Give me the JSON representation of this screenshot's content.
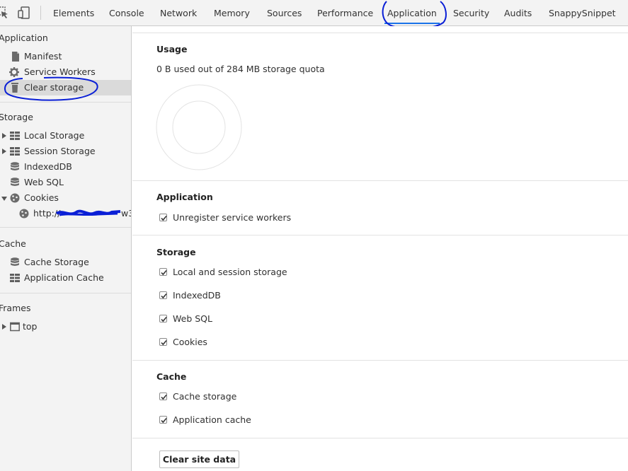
{
  "toolbar": {
    "tabs": [
      {
        "label": "Elements"
      },
      {
        "label": "Console"
      },
      {
        "label": "Network"
      },
      {
        "label": "Memory"
      },
      {
        "label": "Sources"
      },
      {
        "label": "Performance"
      },
      {
        "label": "Application",
        "active": true
      },
      {
        "label": "Security"
      },
      {
        "label": "Audits"
      },
      {
        "label": "SnappySnippet"
      }
    ]
  },
  "sidebar": {
    "application": {
      "title": "Application",
      "items": [
        {
          "label": "Manifest",
          "icon": "document-icon"
        },
        {
          "label": "Service Workers",
          "icon": "gear-icon"
        },
        {
          "label": "Clear storage",
          "icon": "trash-icon",
          "selected": true
        }
      ]
    },
    "storage": {
      "title": "Storage",
      "items": [
        {
          "label": "Local Storage",
          "icon": "grid-icon",
          "expandable": true
        },
        {
          "label": "Session Storage",
          "icon": "grid-icon",
          "expandable": true
        },
        {
          "label": "IndexedDB",
          "icon": "database-icon"
        },
        {
          "label": "Web SQL",
          "icon": "database-icon"
        },
        {
          "label": "Cookies",
          "icon": "cookie-icon",
          "expanded": true
        }
      ],
      "cookie_child": {
        "label": "http://",
        "label_tail": "w3",
        "icon": "cookie-icon"
      }
    },
    "cache": {
      "title": "Cache",
      "items": [
        {
          "label": "Cache Storage",
          "icon": "database-icon"
        },
        {
          "label": "Application Cache",
          "icon": "grid-icon"
        }
      ]
    },
    "frames": {
      "title": "Frames",
      "items": [
        {
          "label": "top",
          "icon": "frame-icon",
          "expandable": true
        }
      ]
    }
  },
  "main": {
    "usage": {
      "title": "Usage",
      "summary": "0 B used out of 284 MB storage quota"
    },
    "application": {
      "title": "Application",
      "options": [
        {
          "label": "Unregister service workers",
          "checked": true
        }
      ]
    },
    "storage": {
      "title": "Storage",
      "options": [
        {
          "label": "Local and session storage",
          "checked": true
        },
        {
          "label": "IndexedDB",
          "checked": true
        },
        {
          "label": "Web SQL",
          "checked": true
        },
        {
          "label": "Cookies",
          "checked": true
        }
      ]
    },
    "cache": {
      "title": "Cache",
      "options": [
        {
          "label": "Cache storage",
          "checked": true
        },
        {
          "label": "Application cache",
          "checked": true
        }
      ]
    },
    "clear_button": "Clear site data"
  },
  "colors": {
    "accent": "#1a73e8",
    "annotation": "#0a1fd6",
    "sidebar_bg": "#f3f3f3",
    "selected_bg": "#dadada"
  }
}
